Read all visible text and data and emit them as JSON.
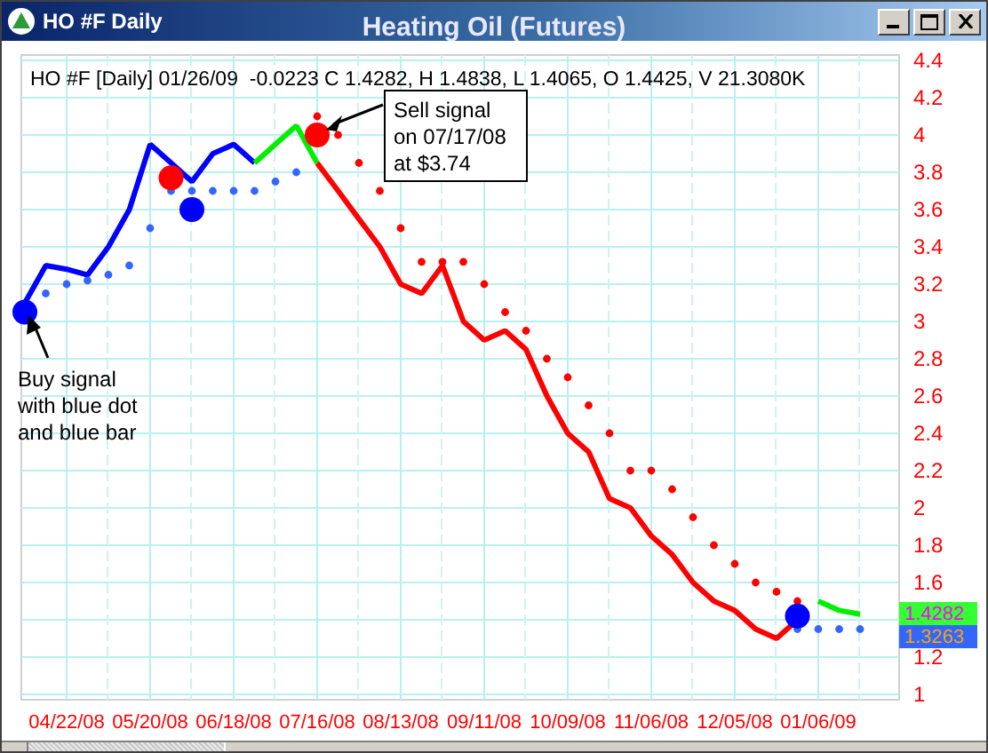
{
  "window": {
    "title": "HO #F Daily",
    "chart_title": "Heating Oil (Futures)"
  },
  "chart": {
    "info": "HO #F [Daily] 01/26/09  -0.0223 C 1.4282, H 1.4838, L 1.4065, O 1.4425, V 21.3080K",
    "price_labels": [
      {
        "text": "1.4282",
        "color": "#33ff33"
      },
      {
        "text": "1.3263",
        "color": "#3366ff"
      }
    ],
    "chart_data": {
      "type": "line",
      "ylim": [
        1,
        4.4
      ],
      "grid": true,
      "categories": [
        null,
        null,
        "04/22/08",
        null,
        null,
        null,
        "05/20/08",
        null,
        null,
        null,
        "06/18/08",
        null,
        null,
        null,
        "07/16/08",
        null,
        null,
        null,
        "08/13/08",
        null,
        null,
        null,
        "09/11/08",
        null,
        null,
        null,
        "10/09/08",
        null,
        null,
        null,
        "11/06/08",
        null,
        null,
        null,
        "12/05/08",
        null,
        null,
        null,
        "01/06/09",
        null,
        null
      ],
      "yticks": [
        1,
        1.2,
        1.6,
        1.8,
        2,
        2.2,
        2.4,
        2.6,
        2.8,
        3,
        3.2,
        3.4,
        3.6,
        3.8,
        4,
        4.2,
        4.4
      ],
      "series": [
        {
          "type": "line",
          "color": "#0000ff",
          "values": [
            3.1,
            3.3,
            3.28,
            3.25,
            3.4,
            3.6,
            3.95,
            3.85,
            3.75,
            3.9,
            3.95,
            3.85,
            null,
            null,
            null,
            null,
            null,
            null,
            null,
            null,
            null,
            null,
            null,
            null,
            null,
            null,
            null,
            null,
            null,
            null,
            null,
            null,
            null,
            null,
            null,
            null,
            null,
            null,
            null,
            null,
            null
          ]
        },
        {
          "type": "line",
          "color": "#00ee00",
          "values": [
            null,
            null,
            null,
            null,
            null,
            null,
            null,
            null,
            null,
            null,
            null,
            3.85,
            3.95,
            4.05,
            3.85,
            null,
            null,
            null,
            null,
            null,
            null,
            null,
            null,
            null,
            null,
            null,
            null,
            null,
            null,
            null,
            null,
            null,
            null,
            null,
            null,
            null,
            null,
            null,
            1.5,
            1.45,
            1.43
          ]
        },
        {
          "type": "line",
          "color": "#ff0000",
          "values": [
            null,
            null,
            null,
            null,
            null,
            null,
            null,
            null,
            null,
            null,
            null,
            null,
            null,
            null,
            3.85,
            3.7,
            3.55,
            3.4,
            3.2,
            3.15,
            3.3,
            3.0,
            2.9,
            2.95,
            2.85,
            2.6,
            2.4,
            2.3,
            2.05,
            2.0,
            1.85,
            1.75,
            1.6,
            1.5,
            1.45,
            1.35,
            1.3,
            1.4,
            null,
            null,
            null
          ]
        },
        {
          "type": "scatter",
          "color": "#3366ff",
          "values": [
            null,
            3.15,
            3.2,
            3.22,
            3.25,
            3.3,
            3.5,
            3.7,
            3.7,
            3.7,
            3.7,
            3.7,
            3.75,
            3.8,
            null,
            null,
            null,
            null,
            null,
            null,
            null,
            null,
            null,
            null,
            null,
            null,
            null,
            null,
            null,
            null,
            null,
            null,
            null,
            null,
            null,
            null,
            null,
            1.35,
            1.35,
            1.35,
            1.35
          ]
        },
        {
          "type": "scatter",
          "color": "#ff0000",
          "values": [
            null,
            null,
            null,
            null,
            null,
            null,
            null,
            null,
            null,
            null,
            null,
            null,
            null,
            null,
            4.1,
            4.0,
            3.85,
            3.7,
            3.5,
            3.32,
            3.32,
            3.32,
            3.2,
            3.05,
            2.95,
            2.8,
            2.7,
            2.55,
            2.4,
            2.2,
            2.2,
            2.1,
            1.95,
            1.8,
            1.7,
            1.6,
            1.55,
            1.5,
            null,
            null,
            null
          ]
        },
        {
          "type": "scatter",
          "color": "#0000ff",
          "values": [
            3.05,
            null,
            null,
            null,
            null,
            null,
            null,
            null,
            3.6,
            null,
            null,
            null,
            null,
            null,
            null,
            null,
            null,
            null,
            null,
            null,
            null,
            null,
            null,
            null,
            null,
            null,
            null,
            null,
            null,
            null,
            null,
            null,
            null,
            null,
            null,
            null,
            null,
            1.42,
            null,
            null,
            null
          ]
        },
        {
          "type": "scatter",
          "color": "#ff0000",
          "values": [
            null,
            null,
            null,
            null,
            null,
            null,
            null,
            3.77,
            null,
            null,
            null,
            null,
            null,
            null,
            4.0,
            null,
            null,
            null,
            null,
            null,
            null,
            null,
            null,
            null,
            null,
            null,
            null,
            null,
            null,
            null,
            null,
            null,
            null,
            null,
            null,
            null,
            null,
            null,
            null,
            null,
            null
          ]
        }
      ],
      "annotations": [
        "Sell signal on 07/17/08 at $3.74",
        "Buy signal with blue dot and blue bar"
      ]
    }
  }
}
